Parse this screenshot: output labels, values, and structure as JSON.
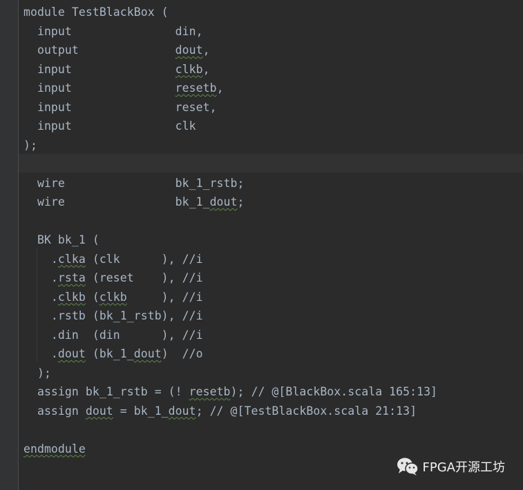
{
  "editor": {
    "language": "verilog",
    "theme_colors": {
      "background": "#2b2b2b",
      "gutter": "#313335",
      "caret_line": "#323232",
      "text": "#a9b7c6",
      "spell_squiggle": "#5f8a4a"
    },
    "lines": [
      [
        {
          "t": "module TestBlackBox ("
        }
      ],
      [
        {
          "t": "  input               din,"
        }
      ],
      [
        {
          "t": "  output              "
        },
        {
          "t": "dout",
          "sq": true
        },
        {
          "t": ","
        }
      ],
      [
        {
          "t": "  input               "
        },
        {
          "t": "clkb",
          "sq": true
        },
        {
          "t": ","
        }
      ],
      [
        {
          "t": "  input               "
        },
        {
          "t": "resetb",
          "sq": true
        },
        {
          "t": ","
        }
      ],
      [
        {
          "t": "  input               reset,"
        }
      ],
      [
        {
          "t": "  input               clk"
        }
      ],
      [
        {
          "t": ");"
        }
      ],
      [
        {
          "t": ""
        }
      ],
      [
        {
          "t": "  wire                bk_1_rstb;"
        }
      ],
      [
        {
          "t": "  wire                bk_1_"
        },
        {
          "t": "dout",
          "sq": true
        },
        {
          "t": ";"
        }
      ],
      [
        {
          "t": ""
        }
      ],
      [
        {
          "t": "  BK bk_1 ("
        }
      ],
      [
        {
          "t": "    ."
        },
        {
          "t": "clka",
          "sq": true
        },
        {
          "t": " (clk      ), //i"
        }
      ],
      [
        {
          "t": "    ."
        },
        {
          "t": "rsta",
          "sq": true
        },
        {
          "t": " (reset    ), //i"
        }
      ],
      [
        {
          "t": "    ."
        },
        {
          "t": "clkb",
          "sq": true
        },
        {
          "t": " ("
        },
        {
          "t": "clkb",
          "sq": true
        },
        {
          "t": "     ), //i"
        }
      ],
      [
        {
          "t": "    .rstb (bk_1_rstb), //i"
        }
      ],
      [
        {
          "t": "    .din  (din      ), //i"
        }
      ],
      [
        {
          "t": "    ."
        },
        {
          "t": "dout",
          "sq": true
        },
        {
          "t": " (bk_1_"
        },
        {
          "t": "dout",
          "sq": true
        },
        {
          "t": ")  //o"
        }
      ],
      [
        {
          "t": "  );"
        }
      ],
      [
        {
          "t": "  assign bk_1_rstb = (! "
        },
        {
          "t": "resetb",
          "sq": true
        },
        {
          "t": "); // @[BlackBox.scala 165:13]"
        }
      ],
      [
        {
          "t": "  assign "
        },
        {
          "t": "dout",
          "sq": true
        },
        {
          "t": " = bk_1_"
        },
        {
          "t": "dout",
          "sq": true
        },
        {
          "t": "; // @[TestBlackBox.scala 21:13]"
        }
      ],
      [
        {
          "t": ""
        }
      ],
      [
        {
          "t": "endmodule",
          "sq": true
        }
      ]
    ]
  },
  "watermark": {
    "icon": "wechat-icon",
    "text": "FPGA开源工坊"
  }
}
